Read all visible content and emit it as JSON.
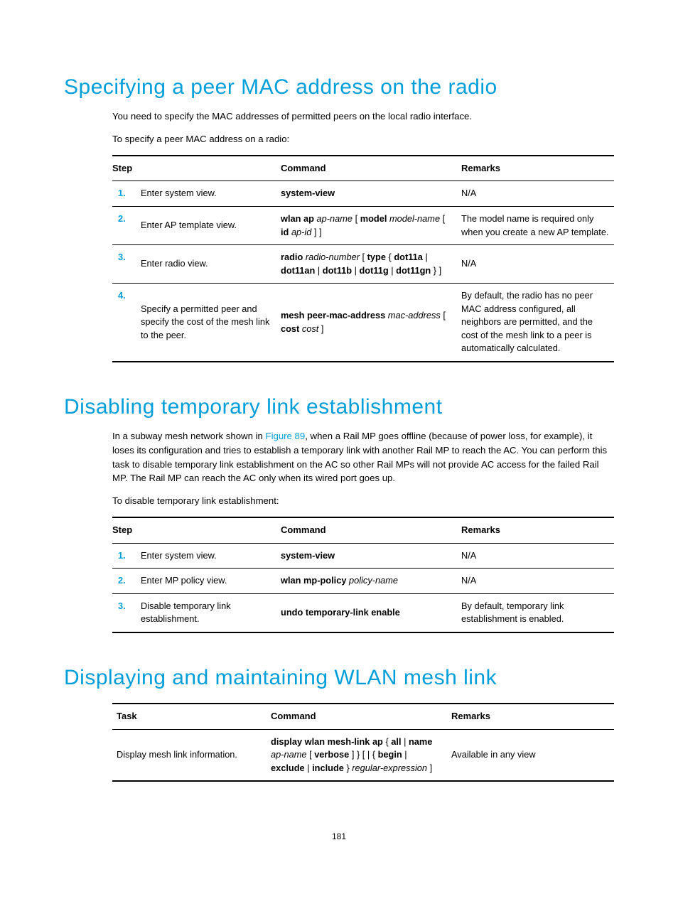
{
  "section1": {
    "heading": "Specifying a peer MAC address on the radio",
    "p1": "You need to specify the MAC addresses of permitted peers on the local radio interface.",
    "p2": "To specify a peer MAC address on a radio:",
    "headers": {
      "step": "Step",
      "command": "Command",
      "remarks": "Remarks"
    },
    "rows": [
      {
        "num": "1.",
        "desc": "Enter system view.",
        "cmd_bold": "system-view",
        "remarks": "N/A"
      },
      {
        "num": "2.",
        "desc": "Enter AP template view.",
        "cmd_parts": [
          "wlan ap ",
          "ap-name",
          " [ ",
          "model ",
          "model-name",
          " [ ",
          "id ",
          "ap-id",
          " ] ]"
        ],
        "remarks": "The model name is required only when you create a new AP template."
      },
      {
        "num": "3.",
        "desc": "Enter radio view.",
        "cmd_parts": [
          "radio ",
          "radio-number",
          " [ ",
          "type ",
          "{ ",
          "dot11a",
          " | ",
          "dot11an",
          " | ",
          "dot11b",
          " | ",
          "dot11g",
          " | ",
          "dot11gn",
          " } ]"
        ],
        "remarks": "N/A"
      },
      {
        "num": "4.",
        "desc": "Specify a permitted peer and specify the cost of the mesh link to the peer.",
        "cmd_parts": [
          "mesh peer-mac-address ",
          "mac-address",
          " [ ",
          "cost ",
          "cost",
          " ]"
        ],
        "remarks": "By default, the radio has no peer MAC address configured, all neighbors are permitted, and the cost of the mesh link to a peer is automatically calculated."
      }
    ]
  },
  "section2": {
    "heading": "Disabling temporary link establishment",
    "p1_pre": "In a subway mesh network shown in ",
    "p1_link": "Figure 89",
    "p1_post": ", when a Rail MP goes offline (because of power loss, for example), it loses its configuration and tries to establish a temporary link with another Rail MP to reach the AC. You can perform this task to disable temporary link establishment on the AC so other Rail MPs will not provide AC access for the failed Rail MP. The Rail MP can reach the AC only when its wired port goes up.",
    "p2": "To disable temporary link establishment:",
    "headers": {
      "step": "Step",
      "command": "Command",
      "remarks": "Remarks"
    },
    "rows": [
      {
        "num": "1.",
        "desc": "Enter system view.",
        "cmd_bold": "system-view",
        "remarks": "N/A"
      },
      {
        "num": "2.",
        "desc": "Enter MP policy view.",
        "cmd_parts": [
          "wlan mp-policy ",
          "policy-name"
        ],
        "remarks": "N/A"
      },
      {
        "num": "3.",
        "desc": "Disable temporary link establishment.",
        "cmd_bold": "undo temporary-link enable",
        "remarks": "By default, temporary link establishment is enabled."
      }
    ]
  },
  "section3": {
    "heading": "Displaying and maintaining WLAN mesh link",
    "headers": {
      "task": "Task",
      "command": "Command",
      "remarks": "Remarks"
    },
    "rows": [
      {
        "task": "Display mesh link information.",
        "cmd_parts": [
          "display wlan mesh-link ap ",
          "{ ",
          "all",
          " | ",
          "name ",
          "ap-name",
          " [ ",
          "verbose",
          " ] } [ | { ",
          "begin",
          " | ",
          "exclude",
          " | ",
          "include",
          " } ",
          "regular-expression",
          " ]"
        ],
        "remarks": "Available in any view"
      }
    ]
  },
  "pageNumber": "181"
}
